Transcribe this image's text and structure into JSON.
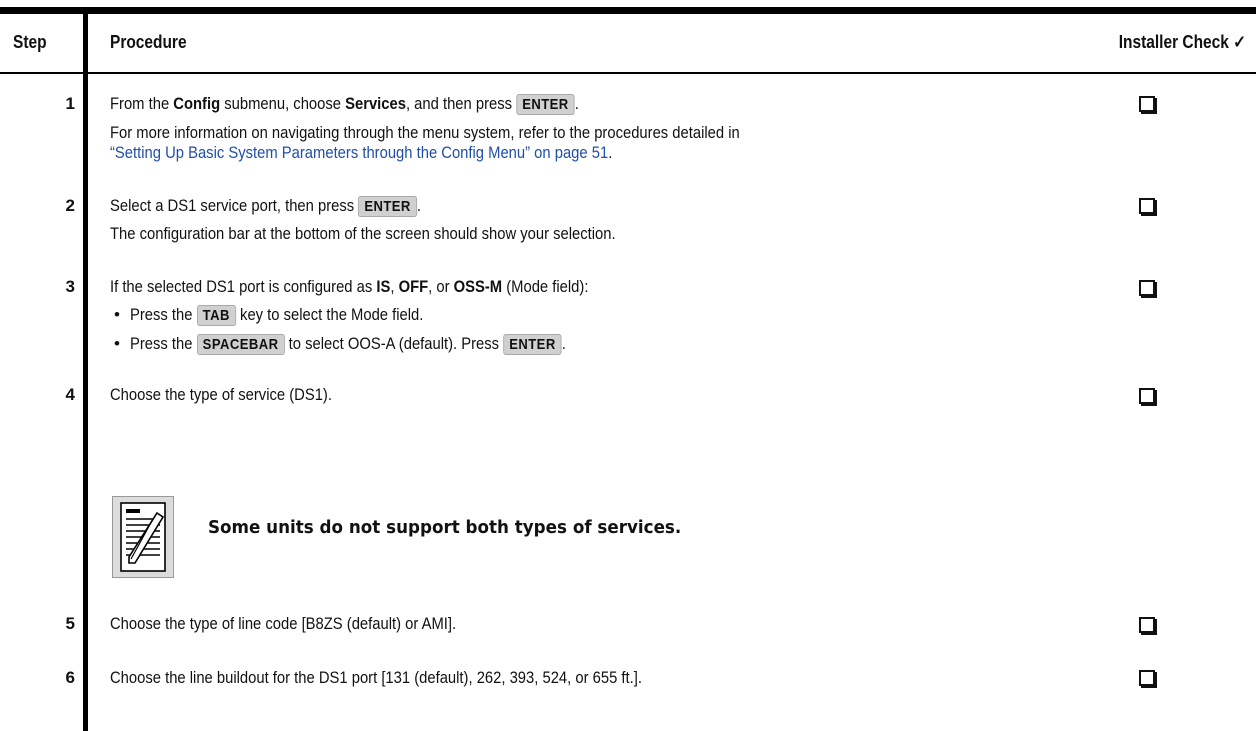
{
  "header": {
    "step": "Step",
    "procedure": "Procedure",
    "check": "Installer Check ✓"
  },
  "steps": [
    {
      "num": "1",
      "line1": {
        "a": "From the ",
        "b1": "Config",
        "c": " submenu, choose ",
        "b2": "Services",
        "d": ", and then press ",
        "key": "ENTER",
        "e": "."
      },
      "line2": "For more information on navigating through the menu system, refer to the procedures detailed in",
      "link": "“Setting Up Basic System Parameters through the Config Menu” on page 51",
      "link_tail": "."
    },
    {
      "num": "2",
      "line1": {
        "a": "Select a DS1 service port, then press ",
        "key": "ENTER",
        "e": "."
      },
      "line2": "The configuration bar at the bottom of the screen should show your selection."
    },
    {
      "num": "3",
      "line1": {
        "a": "If the selected DS1 port is configured as ",
        "b1": "IS",
        "c": ", ",
        "b2": "OFF",
        "d": ", or ",
        "b3": "OSS-M",
        "e": " (Mode field):"
      },
      "bullet1": {
        "a": "Press the ",
        "key": "TAB",
        "e": " key to select the Mode field."
      },
      "bullet2": {
        "a": "Press the ",
        "key": "SPACEBAR",
        "c": " to select OOS-A (default). Press ",
        "key2": "ENTER",
        "e": "."
      }
    },
    {
      "num": "4",
      "line1": "Choose the type of service (DS1).",
      "note": "Some units do not support both types of services."
    },
    {
      "num": "5",
      "line1": "Choose the type of line code [B8ZS (default) or AMI]."
    },
    {
      "num": "6",
      "line1": "Choose the line buildout for the DS1 port [131 (default), 262, 393, 524, or 655 ft.]."
    }
  ],
  "icons": {
    "note": "note-pencil-icon",
    "checkbox": "checkbox-icon"
  }
}
